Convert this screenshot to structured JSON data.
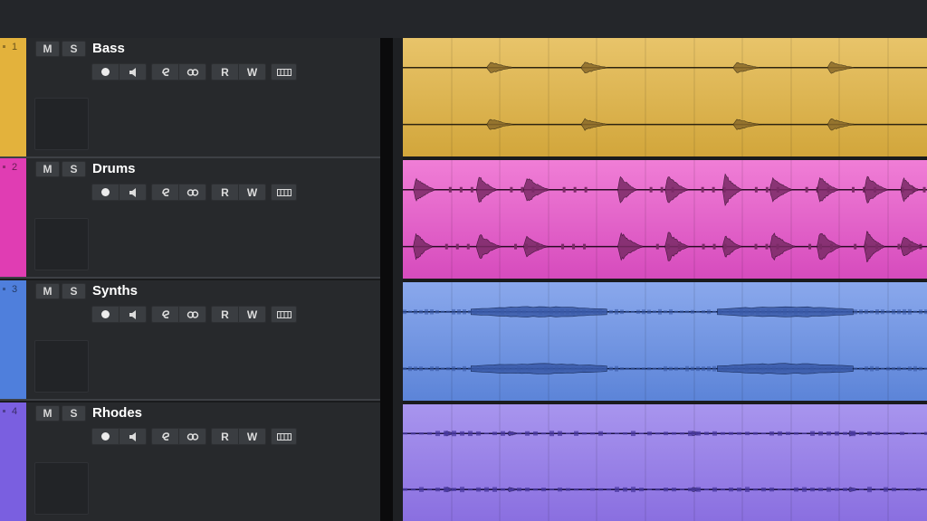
{
  "tracks": [
    {
      "number": "1",
      "name": "Bass",
      "color": "#e3b23c",
      "lane_top": "#e8c46a",
      "lane_bottom": "#d2a63b",
      "wave": "#8a6a2a",
      "line": "#2d2410",
      "mute_label": "M",
      "solo_label": "S",
      "read_label": "R",
      "write_label": "W",
      "blobs": [
        0.16,
        0.34,
        0.63,
        0.81
      ],
      "style": "bass"
    },
    {
      "number": "2",
      "name": "Drums",
      "color": "#e03db3",
      "lane_top": "#f07ed6",
      "lane_bottom": "#d64bbd",
      "wave": "#7a2a66",
      "line": "#2a0b24",
      "mute_label": "M",
      "solo_label": "S",
      "read_label": "R",
      "write_label": "W",
      "blobs": [
        0.02,
        0.14,
        0.23,
        0.41,
        0.5,
        0.61,
        0.7,
        0.79,
        0.88,
        0.95
      ],
      "style": "drums"
    },
    {
      "number": "3",
      "name": "Synths",
      "color": "#4f7fdc",
      "lane_top": "#8aa8ec",
      "lane_bottom": "#5c84d8",
      "wave": "#3a5aa8",
      "line": "#0c1d44",
      "mute_label": "M",
      "solo_label": "S",
      "read_label": "R",
      "write_label": "W",
      "blobs": [
        0.13,
        0.6
      ],
      "style": "synths"
    },
    {
      "number": "4",
      "name": "Rhodes",
      "color": "#7a5fe0",
      "lane_top": "#a895ee",
      "lane_bottom": "#8a6fe0",
      "wave": "#4a3aa0",
      "line": "#1b1244",
      "mute_label": "M",
      "solo_label": "S",
      "read_label": "R",
      "write_label": "W",
      "blobs": [
        0.08,
        0.2,
        0.55,
        0.85
      ],
      "style": "rhodes"
    }
  ]
}
